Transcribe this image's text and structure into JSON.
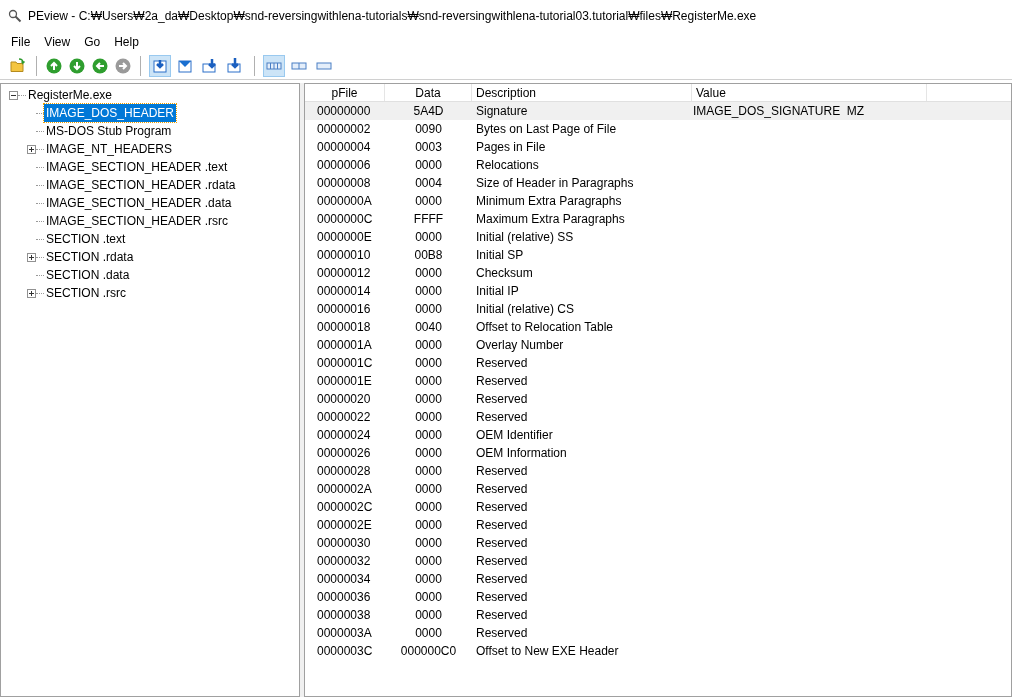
{
  "window": {
    "title": "PEview - C:₩Users₩2a_da₩Desktop₩snd-reversingwithlena-tutorials₩snd-reversingwithlena-tutorial03.tutorial₩files₩RegisterMe.exe"
  },
  "menu": [
    "File",
    "View",
    "Go",
    "Help"
  ],
  "nav_buttons": [
    {
      "kind": "up",
      "disabled": false
    },
    {
      "kind": "down",
      "disabled": false
    },
    {
      "kind": "back",
      "disabled": false
    },
    {
      "kind": "forward",
      "disabled": true
    }
  ],
  "view_buttons": [
    {
      "kind": "hex",
      "selected": true
    },
    {
      "kind": "fields",
      "selected": false
    },
    {
      "kind": "next",
      "selected": false
    },
    {
      "kind": "prev",
      "selected": false
    }
  ],
  "layout_buttons": [
    {
      "kind": "wide",
      "selected": true
    },
    {
      "kind": "medium",
      "selected": false
    },
    {
      "kind": "narrow",
      "selected": false
    }
  ],
  "tree": [
    {
      "label": "RegisterMe.exe",
      "kind": "branch",
      "expanded": true,
      "selected": false,
      "children": [
        {
          "label": "IMAGE_DOS_HEADER",
          "kind": "leaf",
          "selected": true
        },
        {
          "label": "MS-DOS Stub Program",
          "kind": "leaf",
          "selected": false
        },
        {
          "label": "IMAGE_NT_HEADERS",
          "kind": "branch",
          "expanded": false,
          "selected": false
        },
        {
          "label": "IMAGE_SECTION_HEADER .text",
          "kind": "leaf",
          "selected": false
        },
        {
          "label": "IMAGE_SECTION_HEADER .rdata",
          "kind": "leaf",
          "selected": false
        },
        {
          "label": "IMAGE_SECTION_HEADER .data",
          "kind": "leaf",
          "selected": false
        },
        {
          "label": "IMAGE_SECTION_HEADER .rsrc",
          "kind": "leaf",
          "selected": false
        },
        {
          "label": "SECTION .text",
          "kind": "leaf",
          "selected": false
        },
        {
          "label": "SECTION .rdata",
          "kind": "branch",
          "expanded": false,
          "selected": false
        },
        {
          "label": "SECTION .data",
          "kind": "leaf",
          "selected": false
        },
        {
          "label": "SECTION .rsrc",
          "kind": "branch",
          "expanded": false,
          "selected": false
        }
      ]
    }
  ],
  "table": {
    "columns": [
      "pFile",
      "Data",
      "Description",
      "Value"
    ],
    "rows": [
      {
        "pfile": "00000000",
        "data": "5A4D",
        "description": "Signature",
        "value": "IMAGE_DOS_SIGNATURE  MZ",
        "selected": true
      },
      {
        "pfile": "00000002",
        "data": "0090",
        "description": "Bytes on Last Page of File",
        "selected": false
      },
      {
        "pfile": "00000004",
        "data": "0003",
        "description": "Pages in File",
        "selected": false
      },
      {
        "pfile": "00000006",
        "data": "0000",
        "description": "Relocations",
        "selected": false
      },
      {
        "pfile": "00000008",
        "data": "0004",
        "description": "Size of Header in Paragraphs",
        "selected": false
      },
      {
        "pfile": "0000000A",
        "data": "0000",
        "description": "Minimum Extra Paragraphs",
        "selected": false
      },
      {
        "pfile": "0000000C",
        "data": "FFFF",
        "description": "Maximum Extra Paragraphs",
        "selected": false
      },
      {
        "pfile": "0000000E",
        "data": "0000",
        "description": "Initial (relative) SS",
        "selected": false
      },
      {
        "pfile": "00000010",
        "data": "00B8",
        "description": "Initial SP",
        "selected": false
      },
      {
        "pfile": "00000012",
        "data": "0000",
        "description": "Checksum",
        "selected": false
      },
      {
        "pfile": "00000014",
        "data": "0000",
        "description": "Initial IP",
        "selected": false
      },
      {
        "pfile": "00000016",
        "data": "0000",
        "description": "Initial (relative) CS",
        "selected": false
      },
      {
        "pfile": "00000018",
        "data": "0040",
        "description": "Offset to Relocation Table",
        "selected": false
      },
      {
        "pfile": "0000001A",
        "data": "0000",
        "description": "Overlay Number",
        "selected": false
      },
      {
        "pfile": "0000001C",
        "data": "0000",
        "description": "Reserved",
        "selected": false
      },
      {
        "pfile": "0000001E",
        "data": "0000",
        "description": "Reserved",
        "selected": false
      },
      {
        "pfile": "00000020",
        "data": "0000",
        "description": "Reserved",
        "selected": false
      },
      {
        "pfile": "00000022",
        "data": "0000",
        "description": "Reserved",
        "selected": false
      },
      {
        "pfile": "00000024",
        "data": "0000",
        "description": "OEM Identifier",
        "selected": false
      },
      {
        "pfile": "00000026",
        "data": "0000",
        "description": "OEM Information",
        "selected": false
      },
      {
        "pfile": "00000028",
        "data": "0000",
        "description": "Reserved",
        "selected": false
      },
      {
        "pfile": "0000002A",
        "data": "0000",
        "description": "Reserved",
        "selected": false
      },
      {
        "pfile": "0000002C",
        "data": "0000",
        "description": "Reserved",
        "selected": false
      },
      {
        "pfile": "0000002E",
        "data": "0000",
        "description": "Reserved",
        "selected": false
      },
      {
        "pfile": "00000030",
        "data": "0000",
        "description": "Reserved",
        "selected": false
      },
      {
        "pfile": "00000032",
        "data": "0000",
        "description": "Reserved",
        "selected": false
      },
      {
        "pfile": "00000034",
        "data": "0000",
        "description": "Reserved",
        "selected": false
      },
      {
        "pfile": "00000036",
        "data": "0000",
        "description": "Reserved",
        "selected": false
      },
      {
        "pfile": "00000038",
        "data": "0000",
        "description": "Reserved",
        "selected": false
      },
      {
        "pfile": "0000003A",
        "data": "0000",
        "description": "Reserved",
        "selected": false
      },
      {
        "pfile": "0000003C",
        "data": "000000C0",
        "description": "Offset to New EXE Header",
        "selected": false
      }
    ]
  }
}
